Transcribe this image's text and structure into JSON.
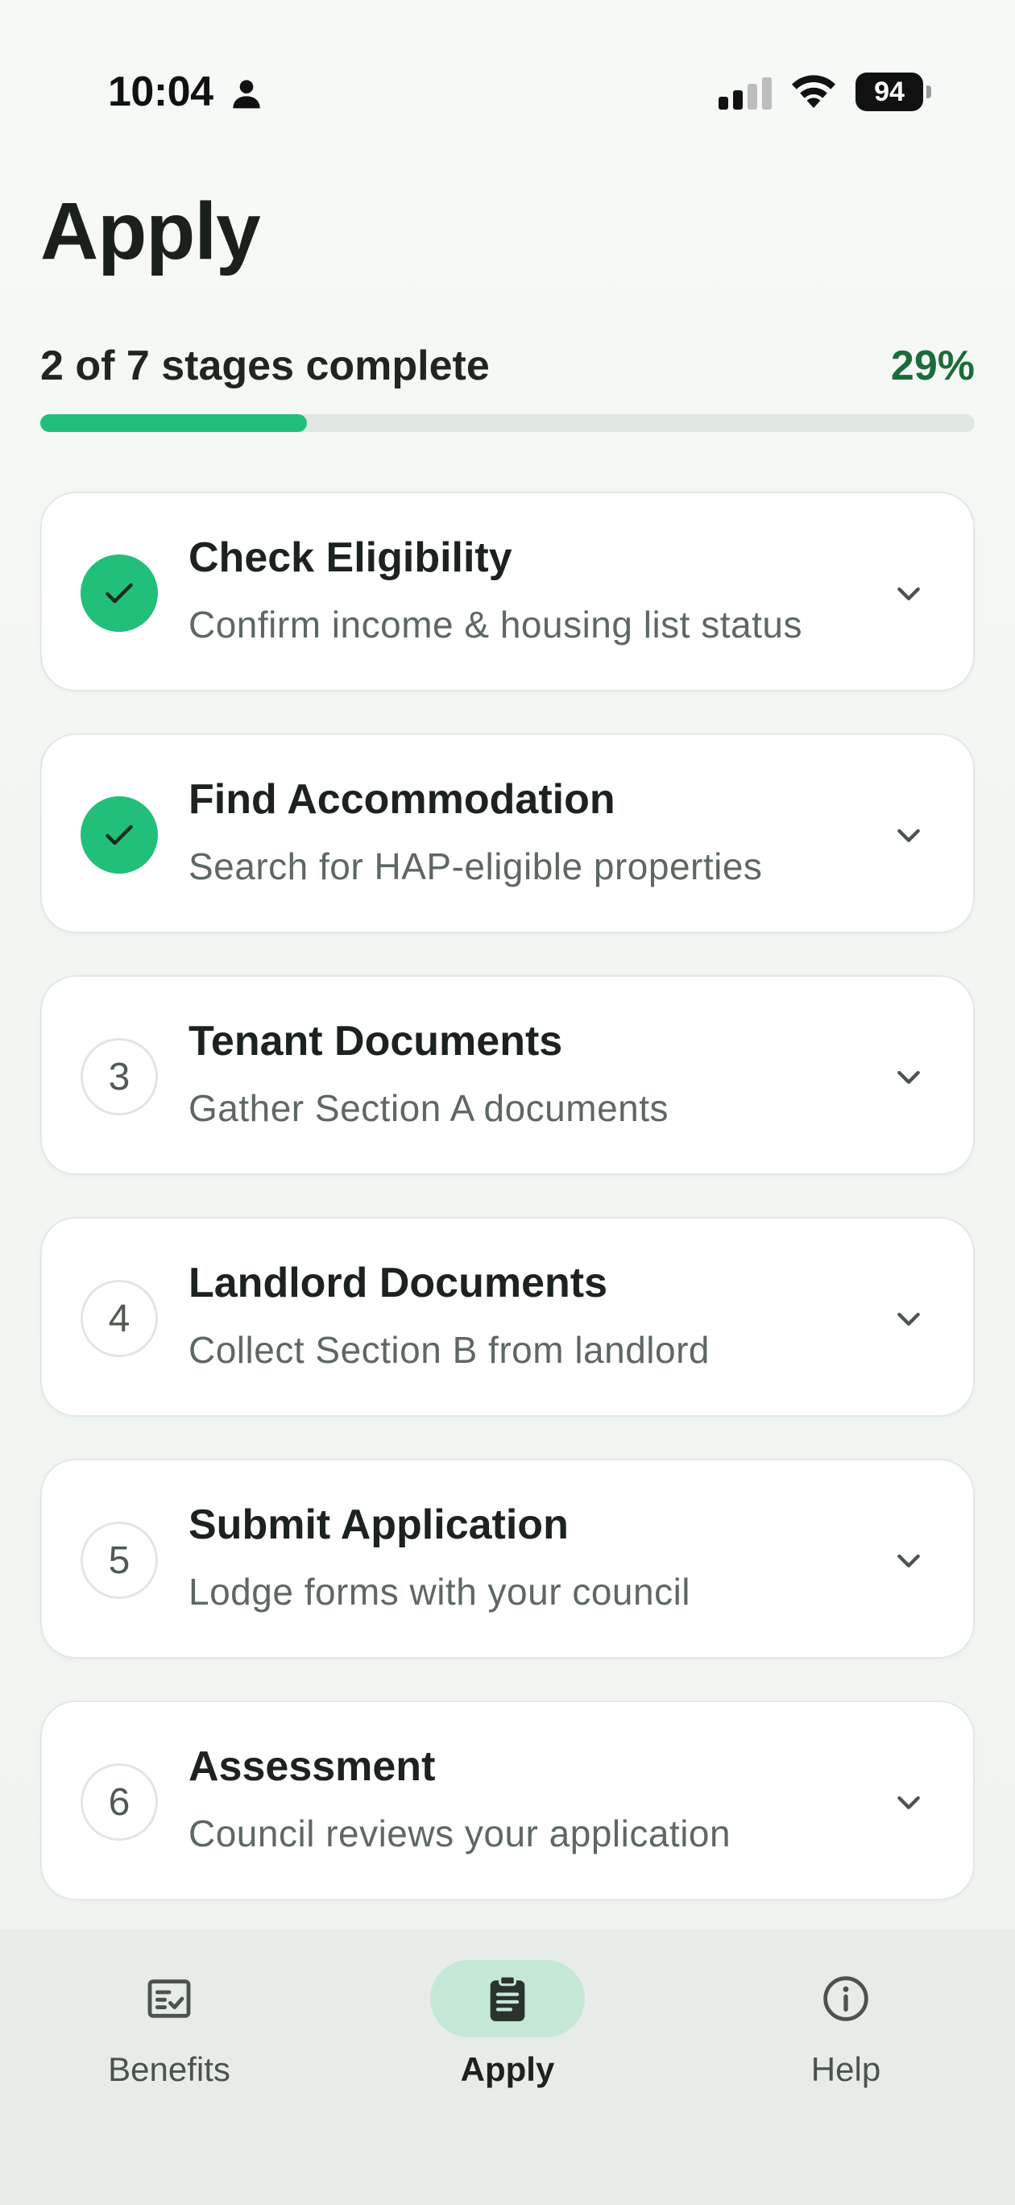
{
  "status_bar": {
    "time": "10:04",
    "person_icon": "person-icon",
    "signal_icon": "cellular-signal-icon",
    "wifi_icon": "wifi-icon",
    "battery_level": "94"
  },
  "page": {
    "title": "Apply"
  },
  "progress": {
    "label": "2 of 7 stages complete",
    "percent_text": "29%",
    "fraction": 0.2857,
    "accent_color": "#21bf7b",
    "percent_color": "#1d6b3a"
  },
  "stages": [
    {
      "status": "complete",
      "number": "",
      "title": "Check Eligibility",
      "subtitle": "Confirm income & housing list status",
      "icon": "check-icon"
    },
    {
      "status": "complete",
      "number": "",
      "title": "Find Accommodation",
      "subtitle": "Search for HAP-eligible properties",
      "icon": "check-icon"
    },
    {
      "status": "pending",
      "number": "3",
      "title": "Tenant Documents",
      "subtitle": "Gather Section A documents",
      "icon": ""
    },
    {
      "status": "pending",
      "number": "4",
      "title": "Landlord Documents",
      "subtitle": "Collect Section B from landlord",
      "icon": ""
    },
    {
      "status": "pending",
      "number": "5",
      "title": "Submit Application",
      "subtitle": "Lodge forms with your council",
      "icon": ""
    },
    {
      "status": "pending",
      "number": "6",
      "title": "Assessment",
      "subtitle": "Council reviews your application",
      "icon": ""
    }
  ],
  "bottom_nav": {
    "items": [
      {
        "label": "Benefits",
        "icon": "checklist-icon",
        "active": false
      },
      {
        "label": "Apply",
        "icon": "clipboard-icon",
        "active": true
      },
      {
        "label": "Help",
        "icon": "info-icon",
        "active": false
      }
    ],
    "active_pill_color": "#c5e8d6"
  }
}
